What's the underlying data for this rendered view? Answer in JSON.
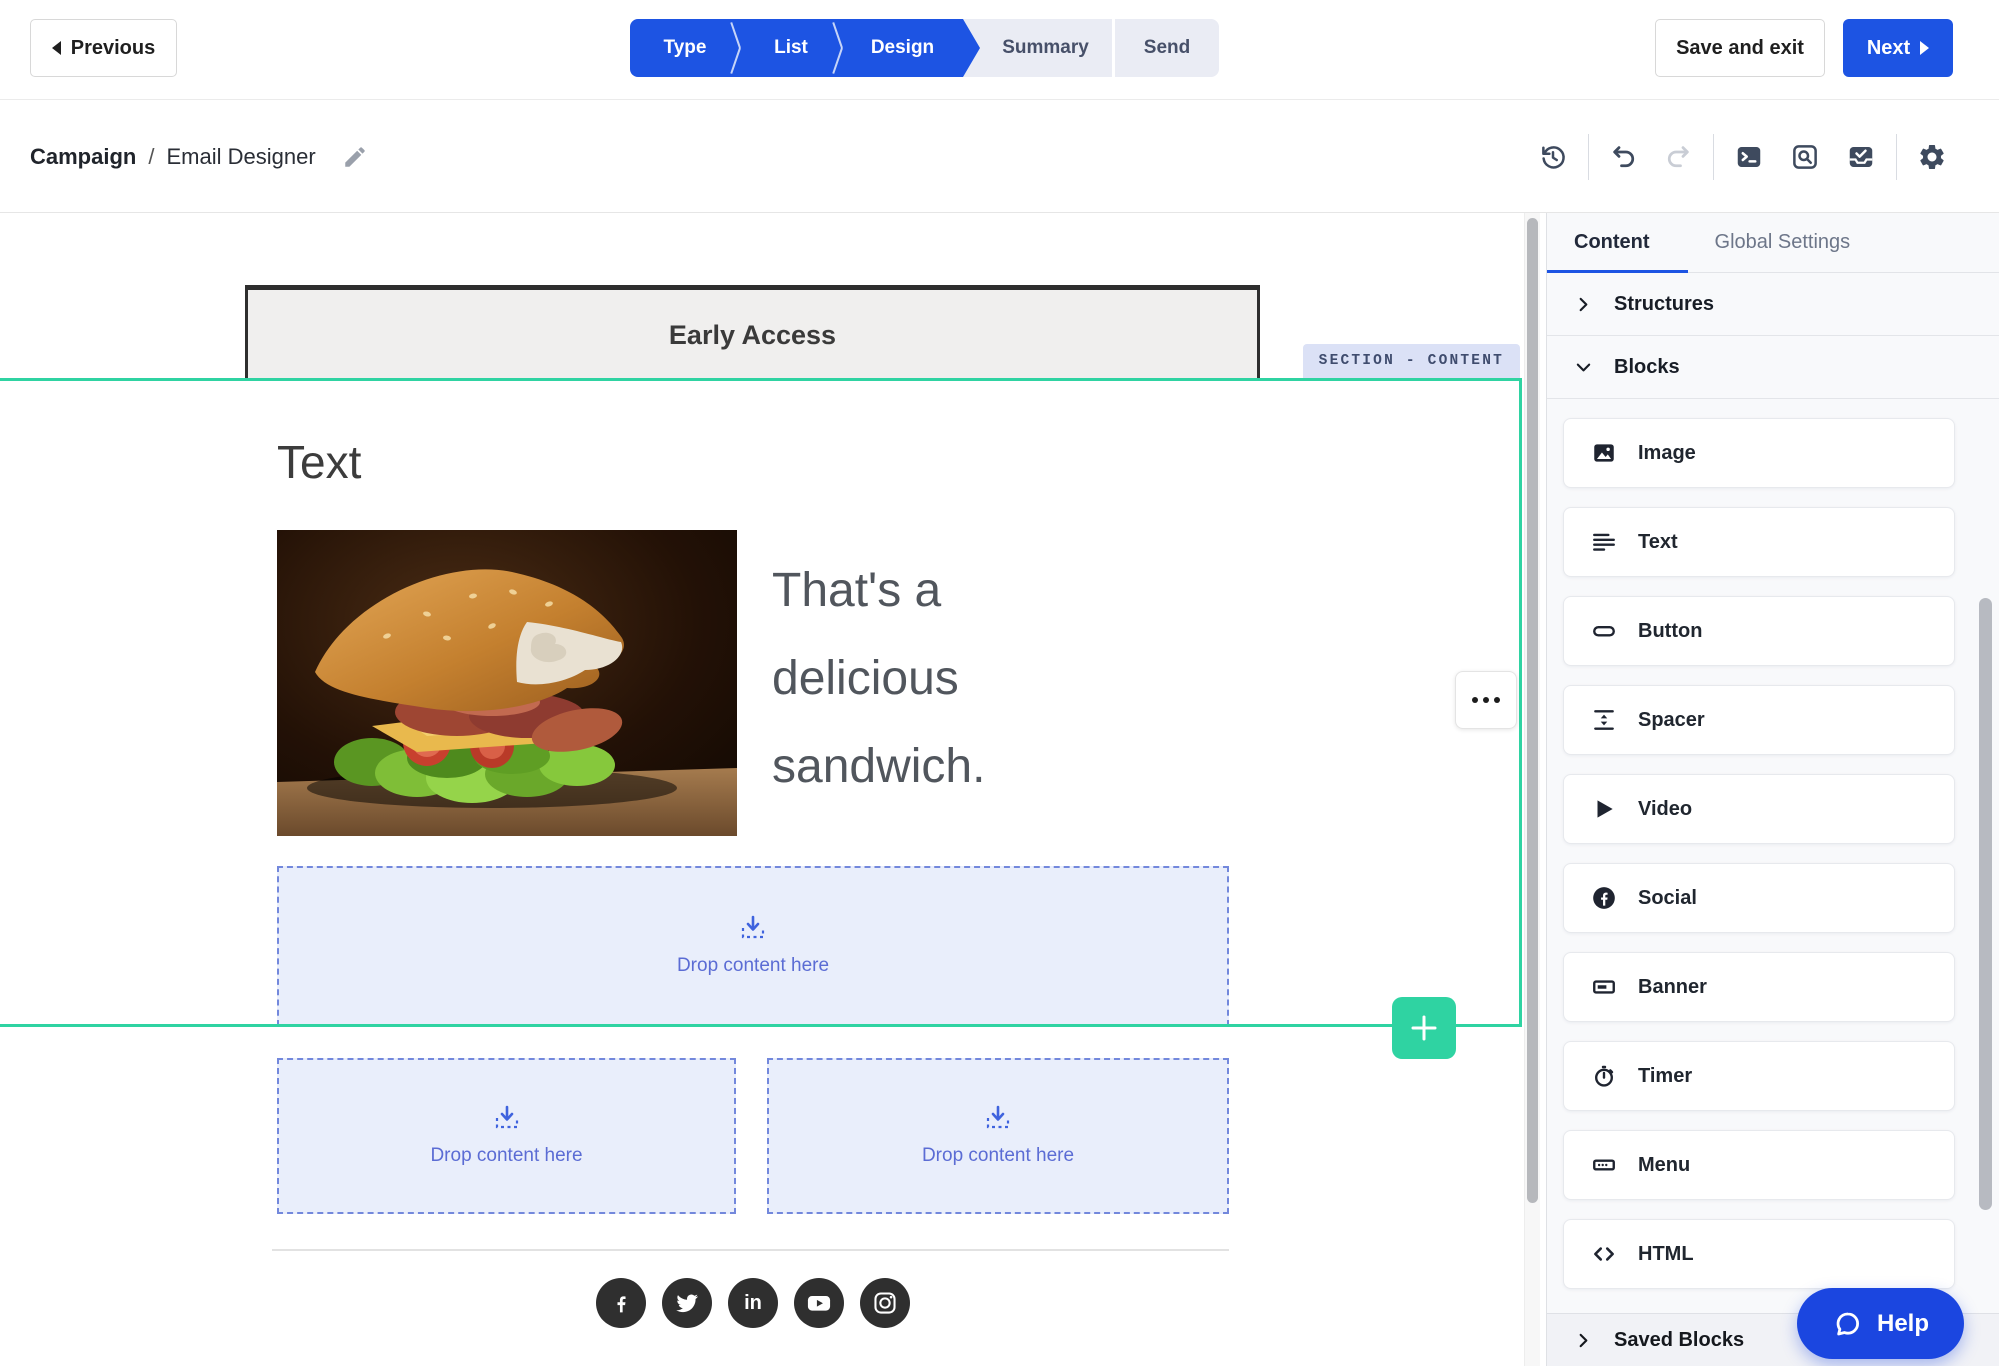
{
  "header": {
    "previous_label": "Previous",
    "steps": [
      {
        "label": "Type",
        "state": "done"
      },
      {
        "label": "List",
        "state": "done"
      },
      {
        "label": "Design",
        "state": "current"
      },
      {
        "label": "Summary",
        "state": "upcoming"
      },
      {
        "label": "Send",
        "state": "upcoming"
      }
    ],
    "save_and_exit_label": "Save and exit",
    "next_label": "Next"
  },
  "breadcrumb": {
    "section": "Campaign",
    "separator": "/",
    "page": "Email Designer"
  },
  "canvas": {
    "email_header_text": "Early Access",
    "section_tag": "SECTION - CONTENT",
    "text_block_heading": "Text",
    "headline": "That's a delicious sandwich.",
    "drop_label": "Drop content here",
    "social_networks": [
      "facebook",
      "twitter",
      "linkedin",
      "youtube",
      "instagram"
    ]
  },
  "sidebar": {
    "tabs": [
      {
        "label": "Content",
        "active": true
      },
      {
        "label": "Global Settings",
        "active": false
      }
    ],
    "groups": {
      "structures": "Structures",
      "blocks": "Blocks",
      "saved": "Saved Blocks"
    },
    "blocks": [
      {
        "label": "Image"
      },
      {
        "label": "Text"
      },
      {
        "label": "Button"
      },
      {
        "label": "Spacer"
      },
      {
        "label": "Video"
      },
      {
        "label": "Social"
      },
      {
        "label": "Banner"
      },
      {
        "label": "Timer"
      },
      {
        "label": "Menu"
      },
      {
        "label": "HTML"
      }
    ],
    "help_label": "Help"
  },
  "colors": {
    "accent_blue": "#1d54e3",
    "help_blue": "#1b46e0",
    "selection_teal": "#2fd3a2",
    "dropzone_bg": "#e9eefb",
    "dropzone_text": "#5b6cd4",
    "section_tag_bg": "#dbe1f6"
  }
}
